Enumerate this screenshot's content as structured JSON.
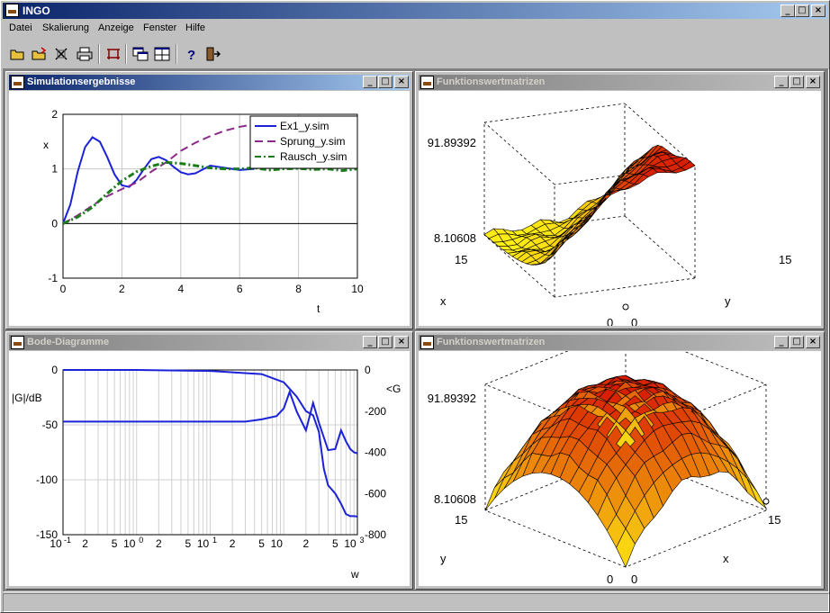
{
  "app": {
    "title": "INGO"
  },
  "menu": {
    "items": [
      "Datei",
      "Skalierung",
      "Anzeige",
      "Fenster",
      "Hilfe"
    ]
  },
  "toolbar": {
    "buttons": [
      "open-icon",
      "open-folder-icon",
      "close-icon",
      "print-icon",
      "frame-icon",
      "cascade-icon",
      "tile-icon",
      "help-icon",
      "exit-icon"
    ]
  },
  "windows": {
    "sim": {
      "title": "Simulationsergebnisse"
    },
    "fwm1": {
      "title": "Funktionswertmatrizen"
    },
    "bode": {
      "title": "Bode-Diagramme"
    },
    "fwm2": {
      "title": "Funktionswertmatrizen"
    }
  },
  "colors": {
    "accent": "#0a246a",
    "ex1": "#1c22d8",
    "sprung": "#8b2a8b",
    "rausch": "#1a7d1a"
  },
  "chart_data": [
    {
      "type": "line",
      "xlabel": "t",
      "ylabel": "x",
      "xlim": [
        0,
        10
      ],
      "ylim": [
        -1,
        2
      ],
      "xticks": [
        "0",
        "2",
        "4",
        "6",
        "8",
        "10"
      ],
      "yticks": [
        "-1",
        "0",
        "1",
        "2"
      ],
      "grid": true,
      "legend_position": "top-right",
      "series": [
        {
          "name": "Ex1_y.sim",
          "style": "solid",
          "x": [
            0,
            0.25,
            0.5,
            0.75,
            1,
            1.25,
            1.5,
            1.75,
            2,
            2.25,
            2.5,
            2.75,
            3,
            3.25,
            3.5,
            3.75,
            4,
            4.25,
            4.5,
            4.75,
            5,
            5.5,
            6,
            6.5
          ],
          "y": [
            0,
            0.35,
            0.95,
            1.4,
            1.58,
            1.5,
            1.22,
            0.9,
            0.7,
            0.67,
            0.8,
            1.0,
            1.18,
            1.22,
            1.16,
            1.04,
            0.94,
            0.9,
            0.92,
            0.99,
            1.06,
            1.02,
            0.98,
            1.0
          ]
        },
        {
          "name": "Sprung_y.sim",
          "style": "dashed",
          "x": [
            0,
            0.5,
            1,
            1.5,
            2,
            2.5,
            3,
            3.5,
            4,
            4.5,
            5,
            5.5,
            6,
            6.5,
            7
          ],
          "y": [
            0,
            0.15,
            0.33,
            0.5,
            0.63,
            0.75,
            0.95,
            1.12,
            1.33,
            1.48,
            1.6,
            1.7,
            1.77,
            1.82,
            1.86
          ]
        },
        {
          "name": "Rausch_y.sim",
          "style": "dash-dot",
          "x": [
            0,
            0.5,
            1,
            1.5,
            2,
            2.5,
            3,
            3.5,
            4,
            4.5,
            5,
            5.5,
            6,
            6.5,
            7,
            7.5,
            8,
            8.5,
            9,
            9.5,
            10
          ],
          "y": [
            0,
            0.12,
            0.3,
            0.55,
            0.78,
            0.95,
            1.05,
            1.12,
            1.1,
            1.06,
            1.02,
            1.0,
            1.0,
            1.02,
            0.98,
            1.0,
            1.01,
            0.99,
            1.0,
            0.97,
            1.0
          ]
        }
      ]
    },
    {
      "type": "surface",
      "zlabels": [
        "91.89392",
        "8.10608"
      ],
      "axis_labels": [
        "x",
        "y",
        "15",
        "15",
        "0",
        "0"
      ]
    },
    {
      "type": "line",
      "xlabel": "w",
      "ylabel_left": "|G|/dB",
      "ylabel_right": "<G",
      "scale": "log-x",
      "ylim_left": [
        -150,
        0
      ],
      "ylim_right": [
        -800,
        0
      ],
      "yticks_left": [
        "0",
        "-50",
        "-100",
        "-150"
      ],
      "yticks_right": [
        "0",
        "-200",
        "-400",
        "-600",
        "-800"
      ],
      "xtick_labels": [
        "10",
        "-1",
        "2",
        "5",
        "10",
        "0",
        "2",
        "5",
        "10",
        "1",
        "2",
        "5",
        "10",
        "2",
        "5",
        "10",
        "3"
      ],
      "grid": true,
      "series": [
        {
          "name": "",
          "axis": "left",
          "x": [
            0.1,
            0.3,
            1,
            3,
            10,
            30,
            50,
            80,
            100,
            120,
            150,
            200,
            250,
            300,
            400,
            500,
            600,
            700,
            800,
            900,
            1000
          ],
          "y": [
            -47,
            -47,
            -47,
            -47,
            -47,
            -47,
            -45,
            -42,
            -35,
            -20,
            -38,
            -55,
            -30,
            -48,
            -73,
            -72,
            -55,
            -65,
            -72,
            -75,
            -76
          ]
        },
        {
          "name": "",
          "axis": "right",
          "x": [
            0.1,
            1,
            10,
            50,
            100,
            150,
            200,
            250,
            300,
            350,
            400,
            500,
            600,
            700,
            800,
            900,
            1000
          ],
          "y": [
            0,
            0,
            -5,
            -20,
            -60,
            -130,
            -200,
            -220,
            -300,
            -480,
            -560,
            -600,
            -650,
            -700,
            -710,
            -710,
            -712
          ]
        }
      ]
    },
    {
      "type": "surface",
      "zlabels": [
        "91.89392",
        "8.10608"
      ],
      "axis_labels": [
        "y",
        "x",
        "15",
        "15",
        "0",
        "0"
      ]
    }
  ]
}
